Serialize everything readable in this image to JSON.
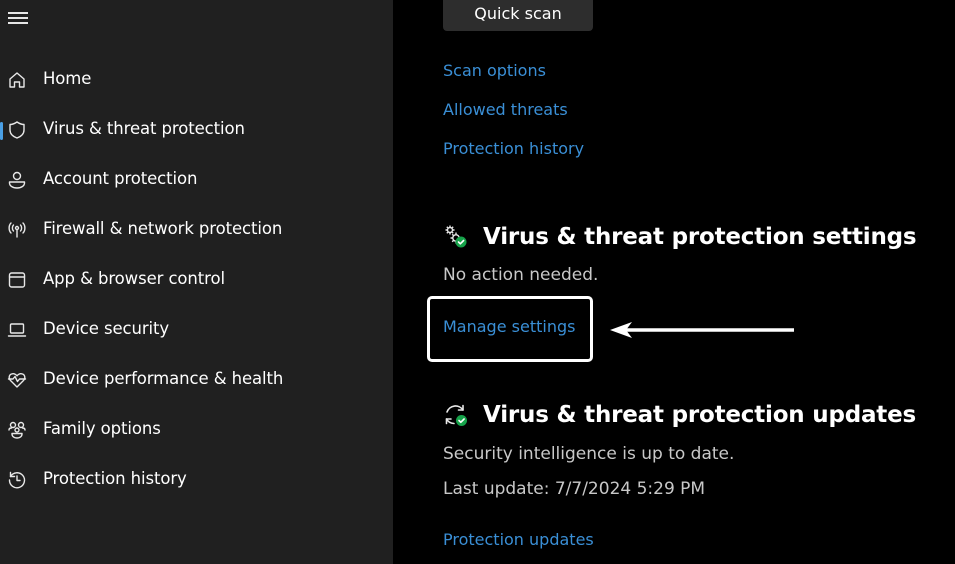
{
  "sidebar": {
    "menu_icon": "hamburger-menu-icon",
    "items": [
      {
        "label": "Home",
        "icon": "home-icon",
        "active": false
      },
      {
        "label": "Virus & threat protection",
        "icon": "shield-icon",
        "active": true
      },
      {
        "label": "Account protection",
        "icon": "person-icon",
        "active": false
      },
      {
        "label": "Firewall & network protection",
        "icon": "wireless-antenna-icon",
        "active": false
      },
      {
        "label": "App & browser control",
        "icon": "app-window-icon",
        "active": false
      },
      {
        "label": "Device security",
        "icon": "laptop-icon",
        "active": false
      },
      {
        "label": "Device performance & health",
        "icon": "heart-pulse-icon",
        "active": false
      },
      {
        "label": "Family options",
        "icon": "family-icon",
        "active": false
      },
      {
        "label": "Protection history",
        "icon": "history-clock-icon",
        "active": false
      }
    ]
  },
  "main": {
    "quick_scan_label": "Quick scan",
    "links": {
      "scan_options": "Scan options",
      "allowed_threats": "Allowed threats",
      "protection_history": "Protection history"
    },
    "settings_section": {
      "icon": "settings-gears-check-icon",
      "title": "Virus & threat protection settings",
      "status": "No action needed.",
      "link": "Manage settings"
    },
    "updates_section": {
      "icon": "sync-check-icon",
      "title": "Virus & threat protection updates",
      "status": "Security intelligence is up to date.",
      "last_update": "Last update: 7/7/2024 5:29 PM",
      "link": "Protection updates"
    }
  },
  "annotation": {
    "highlight": "highlight-box",
    "arrow": "left-pointing-arrow"
  },
  "colors": {
    "sidebar_bg": "#202020",
    "main_bg": "#000000",
    "link": "#3a8fd6",
    "accent": "#4aa0e6",
    "status_ok": "#16a34a"
  }
}
